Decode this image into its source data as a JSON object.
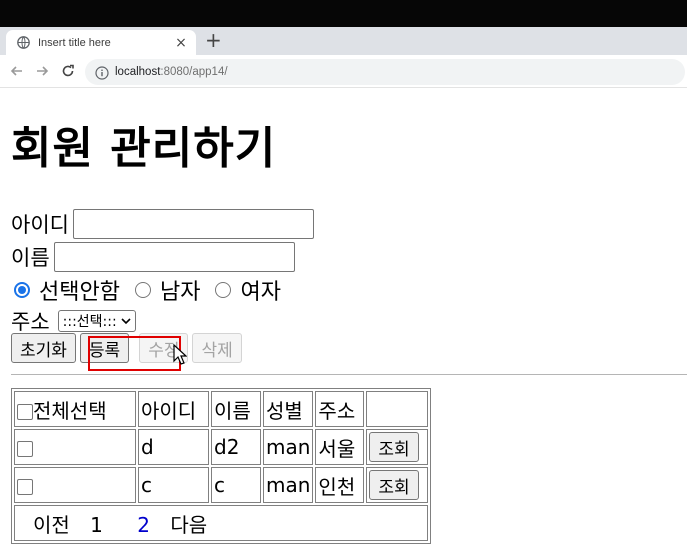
{
  "browser": {
    "tab_title": "Insert title here",
    "tab_close": "×",
    "new_tab": "+",
    "url_host": "localhost",
    "url_rest": ":8080/app14/"
  },
  "page": {
    "title": "회원 관리하기",
    "id_label": "아이디",
    "name_label": "이름",
    "gender_options": [
      "선택안함",
      "남자",
      "여자"
    ],
    "address_label": "주소",
    "address_select_value": ":::선택:::",
    "buttons": {
      "reset": "초기화",
      "register": "등록",
      "edit": "수정",
      "delete": "삭제"
    },
    "table": {
      "headers": [
        "전체선택",
        "아이디",
        "이름",
        "성별",
        "주소"
      ],
      "rows": [
        {
          "id": "d",
          "name": "d2",
          "gender": "man",
          "address": "서울",
          "action": "조회"
        },
        {
          "id": "c",
          "name": "c",
          "gender": "man",
          "address": "인천",
          "action": "조회"
        }
      ],
      "pager": {
        "prev": "이전",
        "pages": [
          "1",
          "2"
        ],
        "next": "다음"
      }
    }
  },
  "colors": {
    "highlight": "#e00000",
    "radio_accent": "#1a73e8",
    "link": "#0000cc"
  }
}
